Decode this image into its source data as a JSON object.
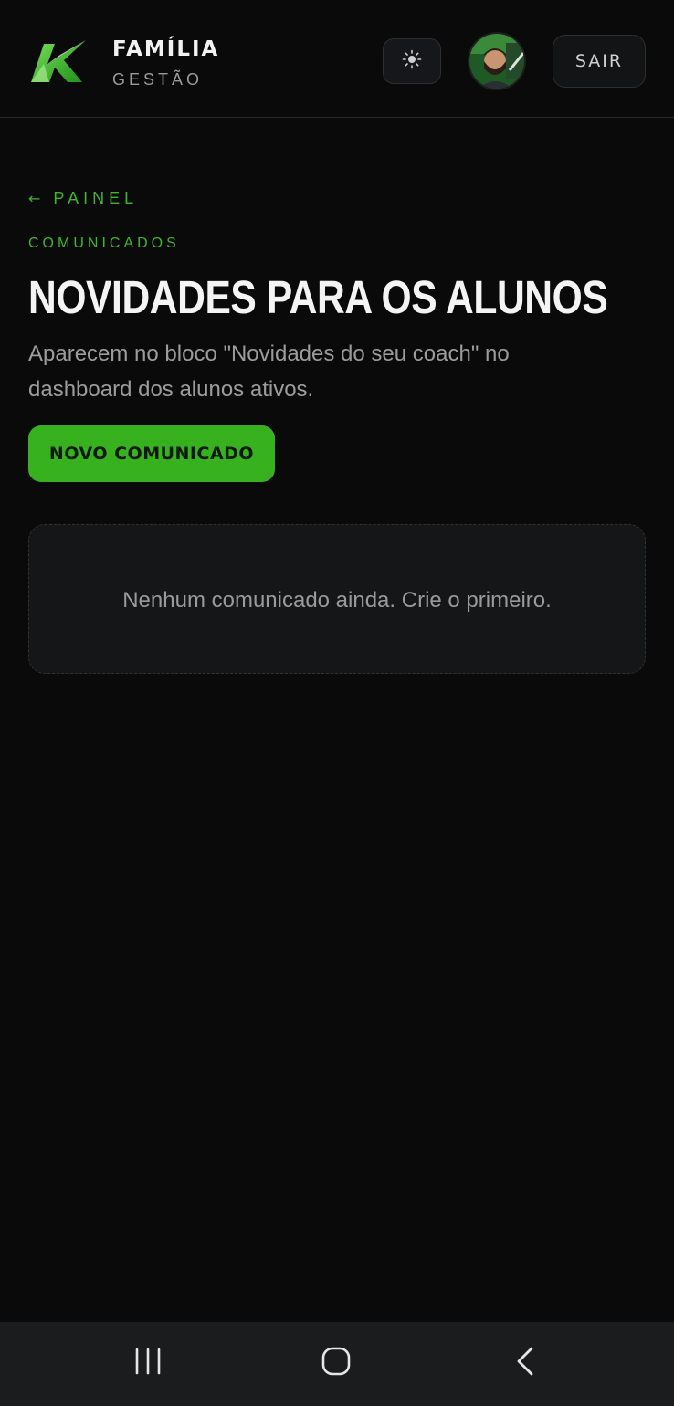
{
  "header": {
    "brand_title": "FAMÍLIA",
    "brand_subtitle": "GESTÃO",
    "theme_toggle_icon": "sun-icon",
    "logout_label": "SAIR"
  },
  "nav": {
    "back_arrow": "←",
    "back_label": "PAINEL"
  },
  "main": {
    "eyebrow": "COMUNICADOS",
    "title": "NOVIDADES PARA OS ALUNOS",
    "description": "Aparecem no bloco \"Novidades do seu coach\" no dashboard dos alunos ativos.",
    "new_button_label": "NOVO COMUNICADO",
    "empty_state": "Nenhum comunicado ainda. Crie o primeiro."
  },
  "system_nav": {
    "recents_icon": "recents-icon",
    "home_icon": "home-icon",
    "back_icon": "back-chevron-icon"
  },
  "colors": {
    "background": "#0a0a0a",
    "accent": "#38b11f",
    "accent_text": "#3fb52a",
    "card": "#141618",
    "muted_text": "#9c9c9c"
  }
}
